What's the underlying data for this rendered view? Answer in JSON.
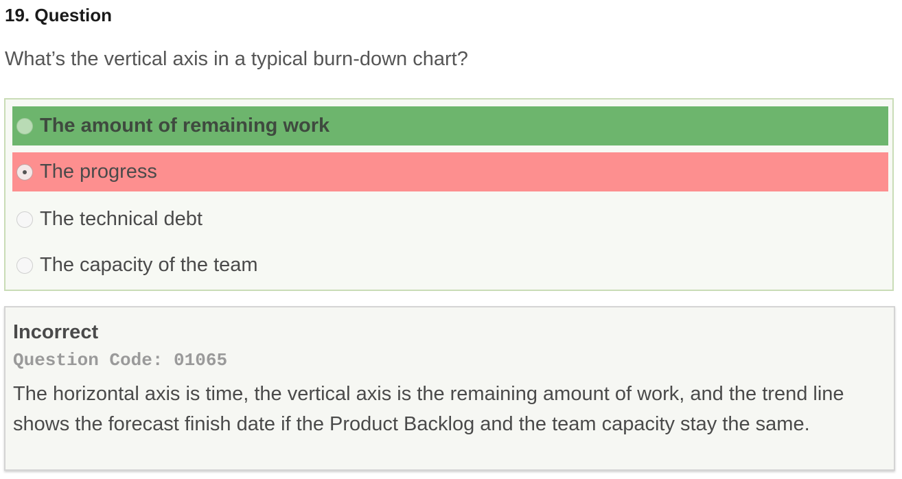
{
  "question": {
    "title": "19. Question",
    "text": "What’s the vertical axis in a typical burn-down chart?"
  },
  "options": [
    {
      "label": "The amount of remaining work",
      "state": "correct",
      "selected": false
    },
    {
      "label": "The progress",
      "state": "wrong",
      "selected": true
    },
    {
      "label": "The technical debt",
      "state": "neutral",
      "selected": false
    },
    {
      "label": "The capacity of the team",
      "state": "neutral",
      "selected": false
    }
  ],
  "feedback": {
    "status": "Incorrect",
    "code": "Question Code: 01065",
    "explanation": "The horizontal axis is time, the vertical axis is the remaining amount of work, and the trend line shows the forecast finish date if the Product Backlog and the team capacity stay the same."
  },
  "colors": {
    "correct": "#6db56d",
    "wrong": "#fd8f8f",
    "panel": "#f7f9f4",
    "panel_border": "#c9dcb6"
  }
}
